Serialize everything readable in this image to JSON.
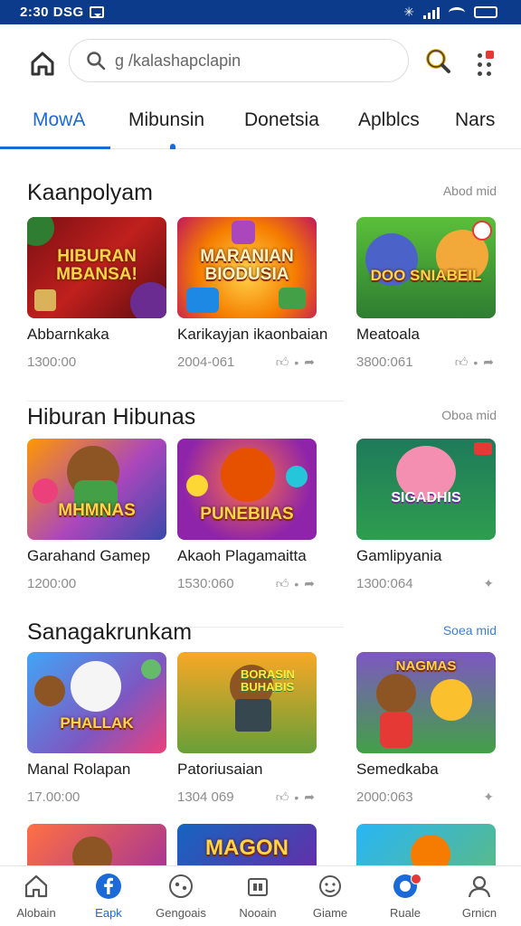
{
  "status_bar": {
    "time": "2:30 DSG"
  },
  "search": {
    "placeholder": "g /kalashapclapin"
  },
  "tabs": [
    {
      "label": "MowA",
      "active": true
    },
    {
      "label": "Mibunsin",
      "active": false
    },
    {
      "label": "Donetsia",
      "active": false
    },
    {
      "label": "Aplblcs",
      "active": false
    },
    {
      "label": "Nars",
      "active": false
    }
  ],
  "sections": [
    {
      "title": "Kaanpolyam",
      "more": "Abod mid",
      "cards": [
        {
          "name": "Abbarnkaka",
          "meta": "1300:00",
          "art": "HIBURAN MBANSA!",
          "actions": false
        },
        {
          "name": "Karikayjan ikaonbaian",
          "meta": "2004-061",
          "art": "MARANIAN BIODUSIA",
          "actions": true
        },
        {
          "name": "Meatoala",
          "meta": "3800:061",
          "art": "DOO SNIABEIL",
          "actions": true
        }
      ]
    },
    {
      "title": "Hiburan Hibunas",
      "more": "Oboa mid",
      "cards": [
        {
          "name": "Garahand Gamep",
          "meta": "1200:00",
          "art": "MHMNAS",
          "actions": false
        },
        {
          "name": "Akaoh Plagamaitta",
          "meta": "1530:060",
          "art": "PUNEBIIAS",
          "actions": true
        },
        {
          "name": "Gamlipyania",
          "meta": "1300:064",
          "art": "SIGADHIS",
          "actions": "single"
        }
      ]
    },
    {
      "title": "Sanagakrunkam",
      "more": "Soea mid",
      "cards": [
        {
          "name": "Manal Rolapan",
          "meta": "17.00:00",
          "art": "PHALLAK",
          "actions": false
        },
        {
          "name": "Patoriusaian",
          "meta": "1304 069",
          "art": "BORASIN BUHABIS",
          "actions": true
        },
        {
          "name": "Semedkaba",
          "meta": "2000:063",
          "art": "NAGMAS",
          "actions": "single"
        }
      ]
    },
    {
      "title": "",
      "more": "",
      "cards": [
        {
          "name": "",
          "meta": "",
          "art": "",
          "actions": false
        },
        {
          "name": "",
          "meta": "",
          "art": "MAGON",
          "actions": false
        },
        {
          "name": "",
          "meta": "",
          "art": "",
          "actions": false
        }
      ]
    }
  ],
  "bottom_nav": [
    {
      "label": "Alobain",
      "icon": "home-icon",
      "active": false
    },
    {
      "label": "Eapk",
      "icon": "facebook-icon",
      "active": true
    },
    {
      "label": "Gengoais",
      "icon": "games-icon",
      "active": false
    },
    {
      "label": "Nooain",
      "icon": "box-icon",
      "active": false
    },
    {
      "label": "Giame",
      "icon": "gamepad-icon",
      "active": false
    },
    {
      "label": "Ruale",
      "icon": "app-icon",
      "active": false
    },
    {
      "label": "Grnicn",
      "icon": "profile-icon",
      "active": false
    }
  ],
  "colors": {
    "accent": "#1b6ad8",
    "status_bar": "#0b3b8a",
    "badge": "#e53935"
  }
}
